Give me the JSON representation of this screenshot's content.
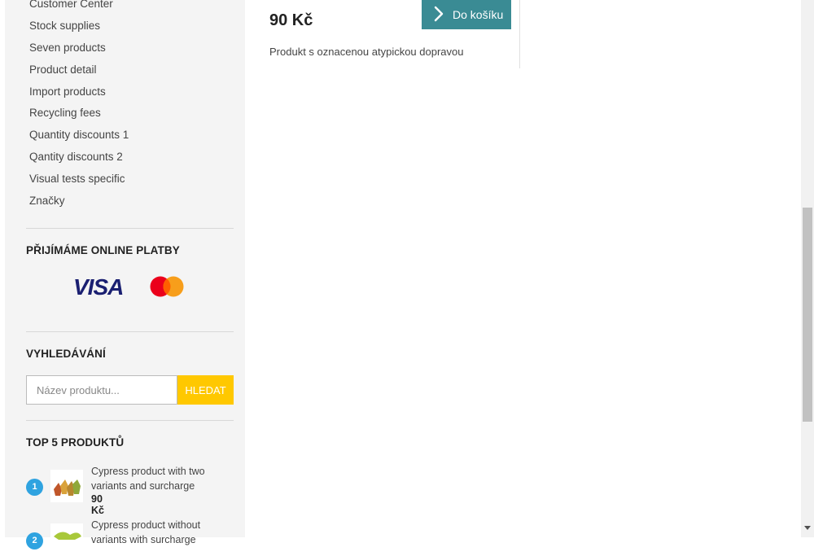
{
  "sidebar": {
    "categories": [
      "Customer Center",
      "Stock supplies",
      "Seven products",
      "Product detail",
      "Import products",
      "Recycling fees",
      "Quantity discounts 1",
      "Qantity discounts 2",
      "Visual tests specific",
      "Značky"
    ],
    "payments": {
      "title": "PŘIJÍMÁME ONLINE PLATBY",
      "visa_text": "VISA"
    },
    "search": {
      "title": "VYHLEDÁVÁNÍ",
      "placeholder": "Název produktu...",
      "button": "HLEDAT"
    },
    "top": {
      "title": "TOP 5 PRODUKTŮ",
      "items": [
        {
          "rank": "1",
          "name": "Cypress product with two variants and surcharge",
          "price": "90 Kč"
        },
        {
          "rank": "2",
          "name": "Cypress product without variants with surcharge",
          "price": ""
        }
      ]
    }
  },
  "product": {
    "price": "90 Kč",
    "cart_button": "Do košíku",
    "note": "Produkt s oznacenou atypickou dopravou"
  },
  "colors": {
    "accent_teal": "#3a8b94",
    "search_yellow": "#ffc800",
    "badge_blue": "#2fa3e0"
  }
}
